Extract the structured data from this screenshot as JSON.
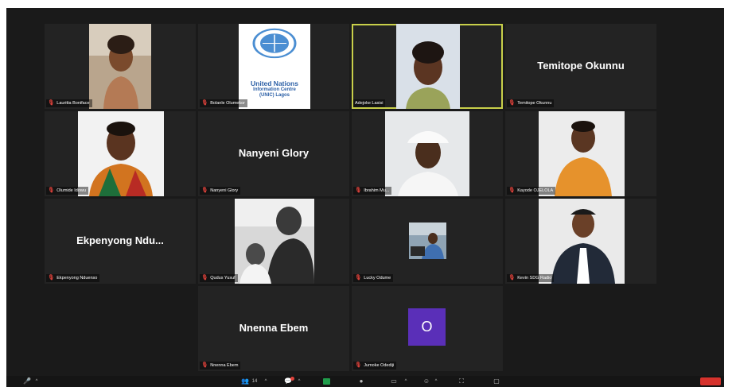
{
  "participants": [
    {
      "name": "Lauritta Boniface",
      "label": "Lauritta Boniface",
      "mic_muted": true,
      "mode": "video"
    },
    {
      "name": "Bolanle Olumekor",
      "label": "Bolanle Olumekor",
      "mic_muted": true,
      "mode": "logo",
      "logo": {
        "line1": "United Nations",
        "line2": "Information Centre",
        "line3": "(UNIC) Lagos"
      }
    },
    {
      "name": "Adejoke Lasisi",
      "label": "Adejoke Lasisi",
      "mic_muted": false,
      "mode": "video",
      "active_speaker": true
    },
    {
      "name": "Temitope Okunnu",
      "label": "Temitope Okunnu",
      "mic_muted": true,
      "mode": "name"
    },
    {
      "name": "Olumide Idowu",
      "label": "Olumide Idowu",
      "mic_muted": true,
      "mode": "video"
    },
    {
      "name": "Nanyeni Glory",
      "label": "Nanyeni Glory",
      "mic_muted": true,
      "mode": "name"
    },
    {
      "name": "Ibrahim Mu...",
      "label": "Ibrahim Mu...",
      "mic_muted": true,
      "mode": "video"
    },
    {
      "name": "Kayode OJELOLA",
      "label": "Kayode OJELOLA",
      "mic_muted": true,
      "mode": "video"
    },
    {
      "name": "Ekpenyong Ndu...",
      "label": "Ekpenyong Nduenso",
      "mic_muted": true,
      "mode": "name"
    },
    {
      "name": "Qudus Yusuf",
      "label": "Qudus Yusuf",
      "mic_muted": true,
      "mode": "video"
    },
    {
      "name": "Lucky Odume",
      "label": "Lucky Odume",
      "mic_muted": true,
      "mode": "video"
    },
    {
      "name": "Kevin SDG Radio",
      "label": "Kevin SDG Radio",
      "mic_muted": true,
      "mode": "video"
    },
    {
      "name": "Nnenna Ebem",
      "label": "Nnenna Ebem",
      "mic_muted": true,
      "mode": "name"
    },
    {
      "name": "Jumoke Odediji",
      "label": "Jumoke Odediji",
      "mic_muted": true,
      "mode": "avatar",
      "avatar_letter": "O"
    }
  ],
  "toolbar": {
    "participants_count": "14",
    "icons": [
      "mute-icon",
      "participants-icon",
      "chat-icon",
      "share-screen-icon",
      "record-icon",
      "closed-caption-icon",
      "reactions-icon",
      "apps-icon",
      "whiteboard-icon",
      "end-button"
    ]
  },
  "colors": {
    "background": "#1a1a1a",
    "tile": "#232323",
    "active_border": "#c8cf4a",
    "muted_mic": "#e0423b",
    "avatar": "#5a2fb8",
    "share_green": "#1f9c4a",
    "end_red": "#d6322c"
  }
}
